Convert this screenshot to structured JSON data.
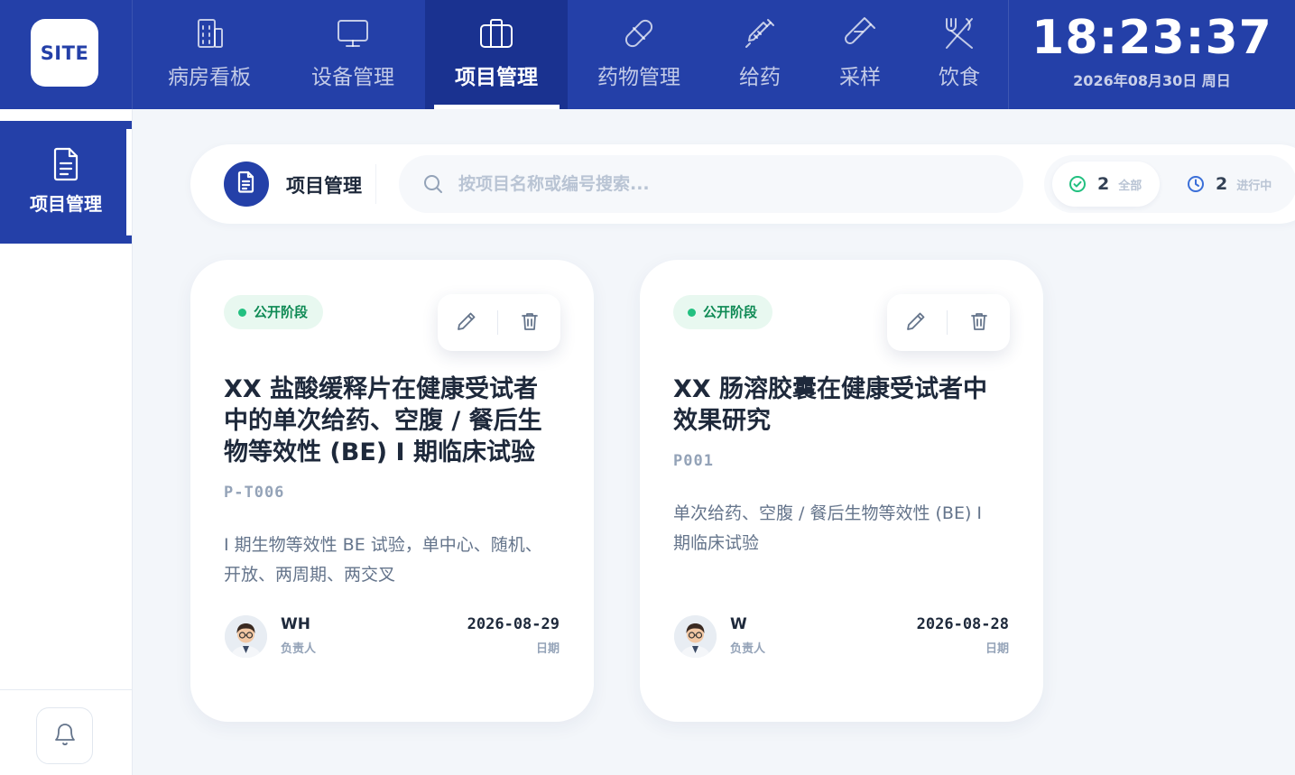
{
  "app": {
    "logo": "SITE"
  },
  "nav": {
    "items": [
      {
        "label": "病房看板",
        "icon": "building-icon"
      },
      {
        "label": "设备管理",
        "icon": "monitor-icon"
      },
      {
        "label": "项目管理",
        "icon": "briefcase-icon",
        "active": true
      },
      {
        "label": "药物管理",
        "icon": "pill-icon"
      },
      {
        "label": "给药",
        "icon": "syringe-icon"
      },
      {
        "label": "采样",
        "icon": "test-tube-icon"
      },
      {
        "label": "饮食",
        "icon": "utensils-icon"
      }
    ]
  },
  "clock": {
    "time": "18:23:37",
    "date": "2026年08月30日 周日"
  },
  "sidebar": {
    "items": [
      {
        "label": "项目管理",
        "icon": "document-icon",
        "active": true
      }
    ],
    "bell_icon": "bell-icon"
  },
  "header": {
    "title": "项目管理",
    "icon": "document-icon",
    "search": {
      "placeholder": "按项目名称或编号搜索...",
      "value": ""
    },
    "stats": [
      {
        "count": "2",
        "label": "全部",
        "icon": "check-circle-icon",
        "color": "#22c080"
      },
      {
        "count": "2",
        "label": "进行中",
        "icon": "clock-icon",
        "color": "#3b6fd8"
      }
    ]
  },
  "projects": [
    {
      "status": "公开阶段",
      "title": "XX 盐酸缓释片在健康受试者中的单次给药、空腹 / 餐后生物等效性 (BE) I 期临床试验",
      "code": "P-T006",
      "description": "I 期生物等效性 BE 试验，单中心、随机、开放、两周期、两交叉",
      "owner": "WH",
      "owner_label": "负责人",
      "date": "2026-08-29",
      "date_label": "日期"
    },
    {
      "status": "公开阶段",
      "title": "XX 肠溶胶囊在健康受试者中效果研究",
      "code": "P001",
      "description": "单次给药、空腹 / 餐后生物等效性 (BE) I 期临床试验",
      "owner": "W",
      "owner_label": "负责人",
      "date": "2026-08-28",
      "date_label": "日期"
    }
  ],
  "colors": {
    "primary": "#2440a8",
    "primary_dark": "#1a3290",
    "success": "#22c080",
    "background": "#f3f6fa"
  }
}
